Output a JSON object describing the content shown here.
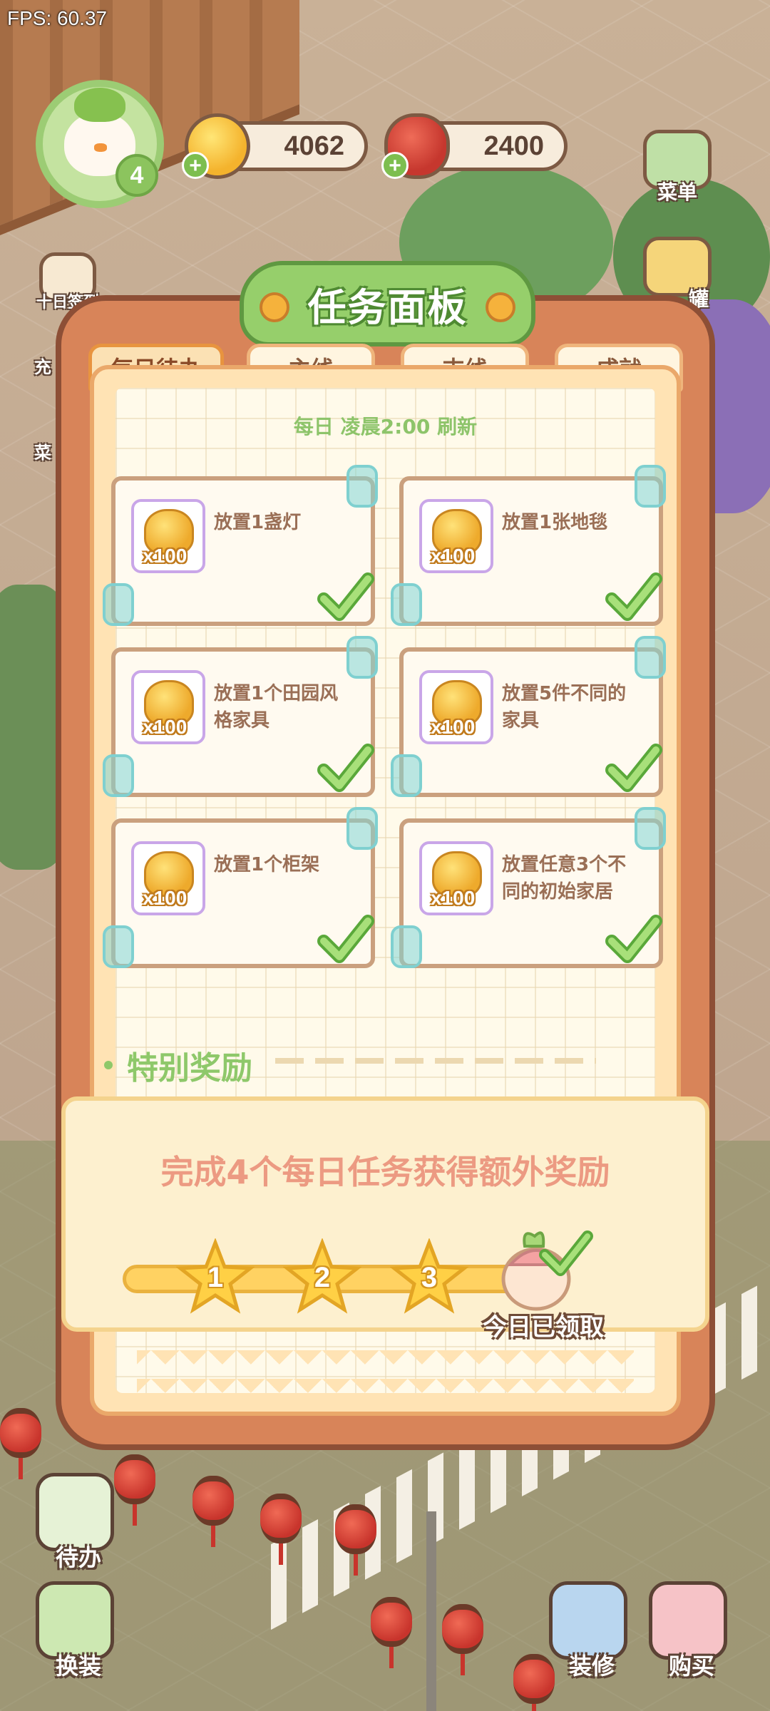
{
  "status": {
    "fps": "FPS: 60.37"
  },
  "player": {
    "level": "4"
  },
  "currency": {
    "coins": "4062",
    "fruit": "2400"
  },
  "side_menu": {
    "menu": "菜单",
    "checkin": "十日签到",
    "jar_partial": "罐",
    "left_partial_1": "充",
    "left_partial_2": "菜"
  },
  "panel": {
    "title": "任务面板",
    "tabs": [
      "每日待办",
      "主线",
      "支线",
      "成就"
    ],
    "refresh_note": "每日 凌晨2:00 刷新",
    "tasks": [
      {
        "label": "放置1盏灯",
        "qty": "x100",
        "done": true
      },
      {
        "label": "放置1张地毯",
        "qty": "x100",
        "done": true
      },
      {
        "label": "放置1个田园风格家具",
        "qty": "x100",
        "done": true
      },
      {
        "label": "放置5件不同的家具",
        "qty": "x100",
        "done": true
      },
      {
        "label": "放置1个柜架",
        "qty": "x100",
        "done": true
      },
      {
        "label": "放置任意3个不同的初始家居",
        "qty": "x100",
        "done": true
      }
    ],
    "special_title": "特别奖励",
    "bonus_text": "完成4个每日任务获得额外奖励",
    "milestones": [
      "1",
      "2",
      "3"
    ],
    "progress_fraction": 1.0,
    "claimed_text": "今日已领取"
  },
  "bottom_bar": {
    "todo": "待办",
    "dress": "换装",
    "decorate": "装修",
    "buy": "购买"
  },
  "colors": {
    "panel_frame": "#d88459",
    "title_green": "#96cf6b",
    "check_green": "#8fd35a",
    "bonus_text": "#ec9a82"
  }
}
